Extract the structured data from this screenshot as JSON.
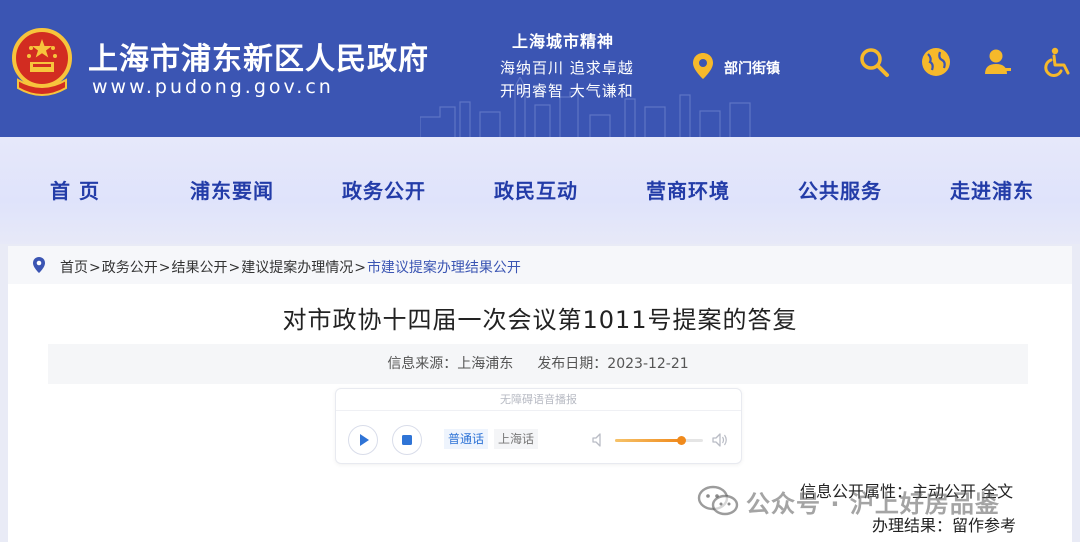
{
  "header": {
    "site_title": "上海市浦东新区人民政府",
    "site_url": "www.pudong.gov.cn",
    "spirit_title": "上海城市精神",
    "spirit_line1": "海纳百川   追求卓越",
    "spirit_line2": "开明睿智   大气谦和",
    "dept_link": "部门街镇",
    "icons": [
      "search-icon",
      "globe-icon",
      "user-icon",
      "accessibility-icon"
    ]
  },
  "nav": {
    "items": [
      "首 页",
      "浦东要闻",
      "政务公开",
      "政民互动",
      "营商环境",
      "公共服务",
      "走进浦东"
    ]
  },
  "breadcrumb": {
    "items": [
      "首页",
      "政务公开",
      "结果公开",
      "建议提案办理情况",
      "市建议提案办理结果公开"
    ],
    "separator": ">"
  },
  "article": {
    "title": "对市政协十四届一次会议第1011号提案的答复",
    "source_label": "信息来源：上海浦东",
    "date_label": "发布日期：2023-12-21"
  },
  "player": {
    "header": "无障碍语音播报",
    "dialect_mandarin": "普通话",
    "dialect_shanghai": "上海话",
    "volume_fraction": 0.75
  },
  "attributes": {
    "public_attr": "信息公开属性：主动公开  全文",
    "handling_result": "办理结果：留作参考"
  },
  "watermark": {
    "text": "公众号 · 沪上好房品鉴"
  },
  "colors": {
    "header_bg": "#3b55b3",
    "nav_text": "#233ca8",
    "accent_orange": "#f08a1c",
    "emblem_red": "#d22c21",
    "emblem_gold": "#f7c43c"
  }
}
